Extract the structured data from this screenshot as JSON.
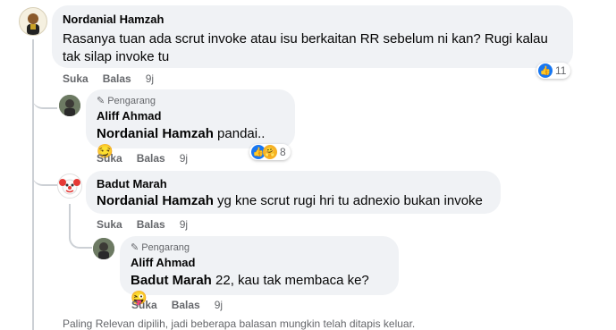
{
  "colors": {
    "like_blue": "#1877f2",
    "bubble_bg": "#f0f2f5",
    "meta_gray": "#65676b",
    "line": "#ccd0d5"
  },
  "comments": [
    {
      "author": "Nordanial Hamzah",
      "text": "Rasanya tuan ada scrut invoke atau isu berkaitan RR sebelum ni kan? Rugi kalau tak silap invoke tu",
      "like_label": "Suka",
      "reply_label": "Balas",
      "time": "9j",
      "reaction_count": "11",
      "reaction_icons": [
        "like-icon"
      ]
    },
    {
      "author_badge": "Pengarang",
      "author": "Aliff Ahmad",
      "mention": "Nordanial Hamzah",
      "text": " pandai.. 😏",
      "like_label": "Suka",
      "reply_label": "Balas",
      "time": "9j",
      "reaction_count": "8",
      "reaction_icons": [
        "like-icon",
        "care-icon"
      ]
    },
    {
      "author": "Badut Marah",
      "mention": "Nordanial Hamzah",
      "text": " yg kne scrut rugi hri tu adnexio bukan invoke",
      "like_label": "Suka",
      "reply_label": "Balas",
      "time": "9j"
    },
    {
      "author_badge": "Pengarang",
      "author": "Aliff Ahmad",
      "mention": "Badut Marah",
      "text": " 22, kau tak membaca ke? 😜",
      "like_label": "Suka",
      "reply_label": "Balas",
      "time": "9j"
    }
  ],
  "footer_note": "Paling Relevan dipilih, jadi beberapa balasan mungkin telah ditapis keluar."
}
